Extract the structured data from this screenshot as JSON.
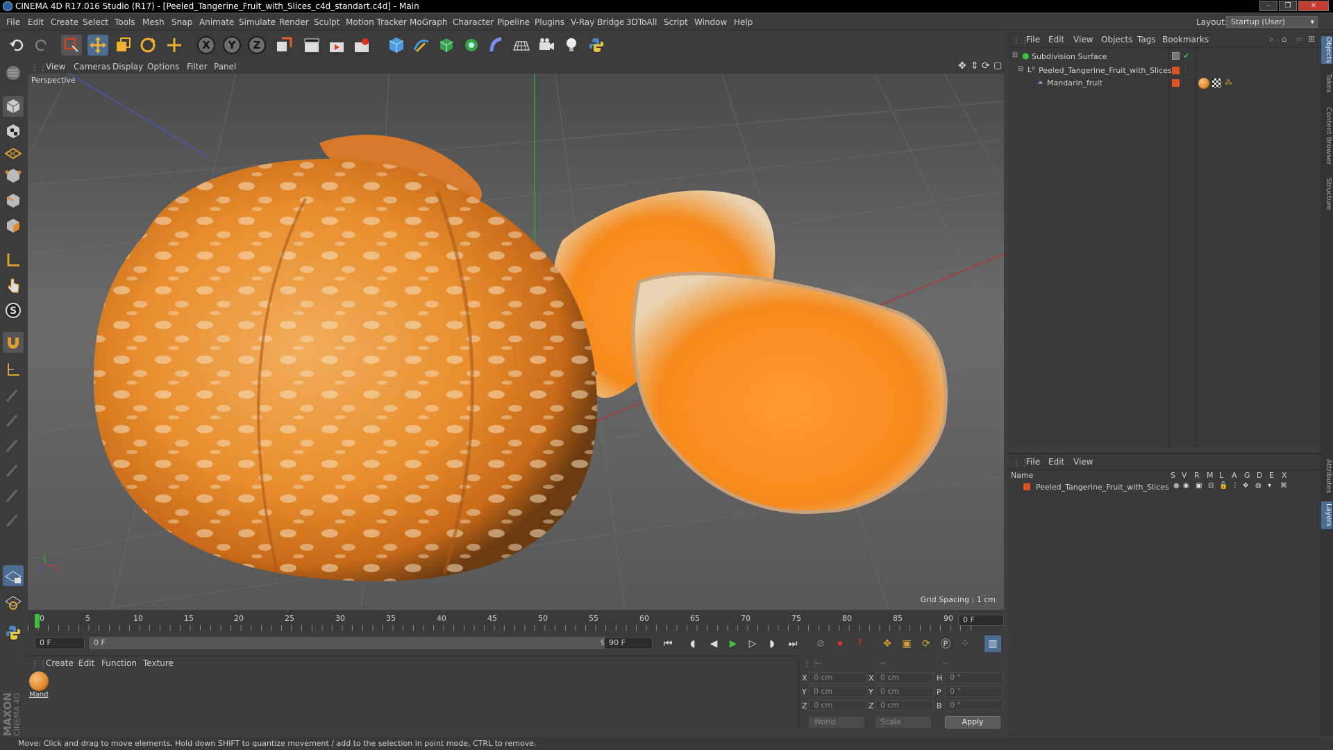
{
  "window": {
    "title": "CINEMA 4D R17.016 Studio (R17) - [Peeled_Tangerine_Fruit_with_Slices_c4d_standart.c4d] - Main",
    "controls": [
      "–",
      "❐",
      "✕"
    ]
  },
  "menubar": {
    "items": [
      "File",
      "Edit",
      "Create",
      "Select",
      "Tools",
      "Mesh",
      "Snap",
      "Animate",
      "Simulate",
      "Render",
      "Sculpt",
      "Motion Tracker",
      "MoGraph",
      "Character",
      "Pipeline",
      "Plugins",
      "V-Ray Bridge",
      "3DToAll",
      "Script",
      "Window",
      "Help"
    ],
    "layout_label": "Layout:",
    "layout_value": "Startup (User)"
  },
  "toolbar": {
    "axis_x": "X",
    "axis_y": "Y",
    "axis_z": "Z"
  },
  "viewport": {
    "menu": [
      "View",
      "Cameras",
      "Display",
      "Options",
      "Filter",
      "Panel"
    ],
    "label": "Perspective",
    "grid_spacing": "Grid Spacing : 1 cm",
    "axes": {
      "x": "X",
      "y": "Y",
      "z": "Z"
    }
  },
  "timeline": {
    "ticks": [
      "0",
      "5",
      "10",
      "15",
      "20",
      "25",
      "30",
      "35",
      "40",
      "45",
      "50",
      "55",
      "60",
      "65",
      "70",
      "75",
      "80",
      "85",
      "90"
    ],
    "current_frame": "0 F"
  },
  "playback": {
    "start_field": "0 F",
    "range_start": "0 F",
    "range_end": "90 F",
    "end_field": "90 F"
  },
  "material_manager": {
    "menu": [
      "Create",
      "Edit",
      "Function",
      "Texture"
    ],
    "materials": [
      {
        "name": "Mand",
        "color": "#e08a2a"
      }
    ]
  },
  "coordinates": {
    "headers": [
      "--",
      "--",
      "--"
    ],
    "rows": [
      {
        "l1": "X",
        "v1": "0 cm",
        "l2": "X",
        "v2": "0 cm",
        "l3": "H",
        "v3": "0 °"
      },
      {
        "l1": "Y",
        "v1": "0 cm",
        "l2": "Y",
        "v2": "0 cm",
        "l3": "P",
        "v3": "0 °"
      },
      {
        "l1": "Z",
        "v1": "0 cm",
        "l2": "Z",
        "v2": "0 cm",
        "l3": "B",
        "v3": "0 °"
      }
    ],
    "mode1": "World",
    "mode2": "Scale",
    "apply": "Apply"
  },
  "object_manager": {
    "menu": [
      "File",
      "Edit",
      "View",
      "Objects",
      "Tags",
      "Bookmarks"
    ],
    "objects": [
      {
        "name": "Subdivision Surface"
      },
      {
        "name": "Peeled_Tangerine_Fruit_with_Slices"
      },
      {
        "name": "Mandarin_fruit"
      }
    ]
  },
  "layer_manager": {
    "menu": [
      "File",
      "Edit",
      "View"
    ],
    "columns": [
      "Name",
      "S",
      "V",
      "R",
      "M",
      "L",
      "A",
      "G",
      "D",
      "E",
      "X"
    ],
    "layers": [
      {
        "name": "Peeled_Tangerine_Fruit_with_Slices",
        "color": "#d9541e"
      }
    ]
  },
  "right_tabs": [
    "Objects",
    "Takes",
    "Content Browser",
    "Structure",
    "Attributes",
    "Layers"
  ],
  "status": "Move: Click and drag to move elements. Hold down SHIFT to quantize movement / add to the selection in point mode, CTRL to remove.",
  "branding": {
    "line1": "MAXON",
    "line2": "CINEMA 4D"
  },
  "colors": {
    "accent_blue": "#3d8ee0",
    "orange": "#e08a2a"
  }
}
